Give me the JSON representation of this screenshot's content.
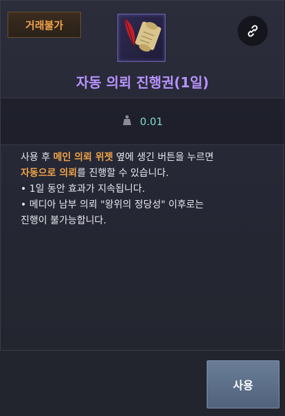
{
  "badge": {
    "trade_label": "거래불가"
  },
  "item": {
    "icon": "quill-and-scroll-icon",
    "title": "자동 의뢰 진행권(1일)",
    "weight_icon": "weight-icon",
    "weight": "0.01"
  },
  "link_icon": "chain-link-icon",
  "description": {
    "line1_a": "사용 후 ",
    "line1_b": "메인 의뢰 위젯",
    "line1_c": " 옆에 생긴 버튼을 누르면",
    "line2_a": "자동으로 의뢰",
    "line2_b": "를 진행할 수 있습니다.",
    "bullet1": "• 1일 동안 효과가 지속됩니다.",
    "bullet2": "• 메디아 남부 의뢰 \"왕위의 정당성\" 이후로는",
    "bullet2_cont": "진행이 불가능합니다."
  },
  "actions": {
    "use_label": "사용"
  },
  "colors": {
    "accent_orange": "#f0a24a",
    "title_purple": "#b893ff",
    "weight_teal": "#7fd8ce"
  }
}
